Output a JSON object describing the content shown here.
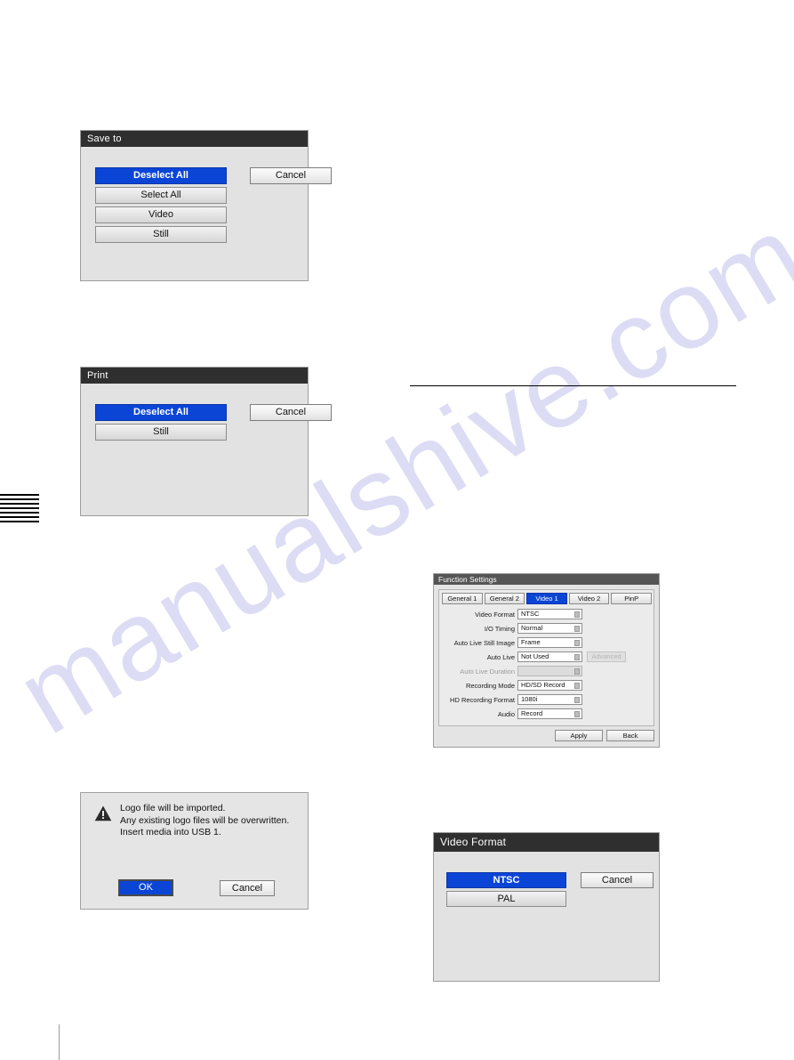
{
  "page": {
    "background": "#ffffff",
    "watermark": "manualshive.com",
    "watermark_color": "#dcdcf5"
  },
  "colors": {
    "selection_blue": "#0a45d6",
    "title_bar_dark": "#2f2f2f",
    "title_bar_gray": "#555555",
    "dialog_face": "#e2e2e2"
  },
  "dialogs": {
    "save_to": {
      "title": "Save to",
      "options": [
        {
          "label": "Deselect All",
          "selected": true
        },
        {
          "label": "Select All",
          "selected": false
        },
        {
          "label": "Video",
          "selected": false
        },
        {
          "label": "Still",
          "selected": false
        }
      ],
      "cancel_label": "Cancel"
    },
    "print": {
      "title": "Print",
      "options": [
        {
          "label": "Deselect All",
          "selected": true
        },
        {
          "label": "Still",
          "selected": false
        }
      ],
      "cancel_label": "Cancel"
    },
    "warning": {
      "icon": "warning-triangle-icon",
      "lines": [
        "Logo file will be imported.",
        "Any existing logo files will be overwritten.",
        "Insert media into USB 1."
      ],
      "ok_label": "OK",
      "cancel_label": "Cancel"
    },
    "function_settings": {
      "title": "Function Settings",
      "tabs": [
        {
          "label": "General 1",
          "active": false
        },
        {
          "label": "General 2",
          "active": false
        },
        {
          "label": "Video 1",
          "active": true
        },
        {
          "label": "Video 2",
          "active": false
        },
        {
          "label": "PinP",
          "active": false
        }
      ],
      "rows": [
        {
          "label": "Video Format",
          "value": "NTSC",
          "disabled": false
        },
        {
          "label": "I/O Timing",
          "value": "Normal",
          "disabled": false
        },
        {
          "label": "Auto Live Still Image",
          "value": "Frame",
          "disabled": false
        },
        {
          "label": "Auto Live",
          "value": "Not Used",
          "disabled": false,
          "extra_button": "Advanced",
          "extra_disabled": true
        },
        {
          "label": "Auto Live Duration",
          "value": "",
          "disabled": true
        },
        {
          "label": "Recording Mode",
          "value": "HD/SD Record",
          "disabled": false
        },
        {
          "label": "HD Recording Format",
          "value": "1080i",
          "disabled": false
        },
        {
          "label": "Audio",
          "value": "Record",
          "disabled": false
        }
      ],
      "apply_label": "Apply",
      "back_label": "Back"
    },
    "video_format": {
      "title": "Video Format",
      "options": [
        {
          "label": "NTSC",
          "selected": true
        },
        {
          "label": "PAL",
          "selected": false
        }
      ],
      "cancel_label": "Cancel"
    }
  }
}
